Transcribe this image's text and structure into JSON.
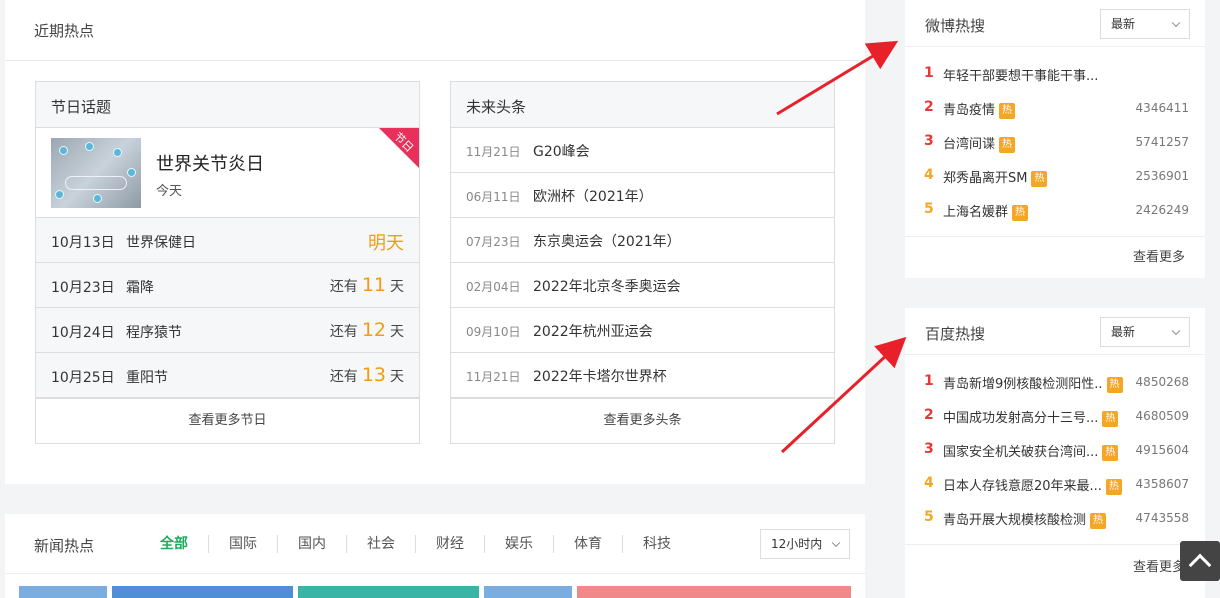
{
  "recent": {
    "title": "近期热点"
  },
  "holiday": {
    "title": "节日话题",
    "featured": {
      "name": "世界关节炎日",
      "when": "今天",
      "ribbon": "节日"
    },
    "items": [
      {
        "date": "10月13日",
        "name": "世界保健日",
        "tomorrow": "明天"
      },
      {
        "date": "10月23日",
        "name": "霜降",
        "prefix": "还有",
        "days": "11",
        "suffix": "天"
      },
      {
        "date": "10月24日",
        "name": "程序猿节",
        "prefix": "还有",
        "days": "12",
        "suffix": "天"
      },
      {
        "date": "10月25日",
        "name": "重阳节",
        "prefix": "还有",
        "days": "13",
        "suffix": "天"
      }
    ],
    "more": "查看更多节日"
  },
  "headlines": {
    "title": "未来头条",
    "items": [
      {
        "date": "11月21日",
        "name": "G20峰会"
      },
      {
        "date": "06月11日",
        "name": "欧洲杯（2021年）"
      },
      {
        "date": "07月23日",
        "name": "东京奥运会（2021年）"
      },
      {
        "date": "02月04日",
        "name": "2022年北京冬季奥运会"
      },
      {
        "date": "09月10日",
        "name": "2022年杭州亚运会"
      },
      {
        "date": "11月21日",
        "name": "2022年卡塔尔世界杯"
      }
    ],
    "more": "查看更多头条"
  },
  "news": {
    "title": "新闻热点",
    "tabs": [
      "全部",
      "国际",
      "国内",
      "社会",
      "财经",
      "娱乐",
      "体育",
      "科技"
    ],
    "range": "12小时内",
    "bar_colors": [
      "#7aaee0",
      "#4e8fd6",
      "#3ab5a5",
      "#7aaee0",
      "#f08a8a"
    ]
  },
  "weibo": {
    "title": "微博热搜",
    "sort": "最新",
    "items": [
      {
        "rank": "1",
        "text": "年轻干部要想干事能干事...",
        "hot": false,
        "count": ""
      },
      {
        "rank": "2",
        "text": "青岛疫情",
        "hot": true,
        "count": "4346411"
      },
      {
        "rank": "3",
        "text": "台湾间谍",
        "hot": true,
        "count": "5741257"
      },
      {
        "rank": "4",
        "text": "郑秀晶离开SM",
        "hot": true,
        "count": "2536901"
      },
      {
        "rank": "5",
        "text": "上海名媛群",
        "hot": true,
        "count": "2426249"
      }
    ],
    "badge": "热",
    "more": "查看更多"
  },
  "baidu": {
    "title": "百度热搜",
    "sort": "最新",
    "items": [
      {
        "rank": "1",
        "text": "青岛新增9例核酸检测阳性..",
        "hot": true,
        "count": "4850268"
      },
      {
        "rank": "2",
        "text": "中国成功发射高分十三号...",
        "hot": true,
        "count": "4680509"
      },
      {
        "rank": "3",
        "text": "国家安全机关破获台湾间...",
        "hot": true,
        "count": "4915604"
      },
      {
        "rank": "4",
        "text": "日本人存钱意愿20年来最...",
        "hot": true,
        "count": "4358607"
      },
      {
        "rank": "5",
        "text": "青岛开展大规模核酸检测",
        "hot": true,
        "count": "4743558"
      }
    ],
    "badge": "热",
    "more": "查看更多"
  },
  "colors": {
    "accent_green": "#1aad5a",
    "orange": "#f39c12",
    "red": "#e53935",
    "arrow": "#e8202a"
  }
}
